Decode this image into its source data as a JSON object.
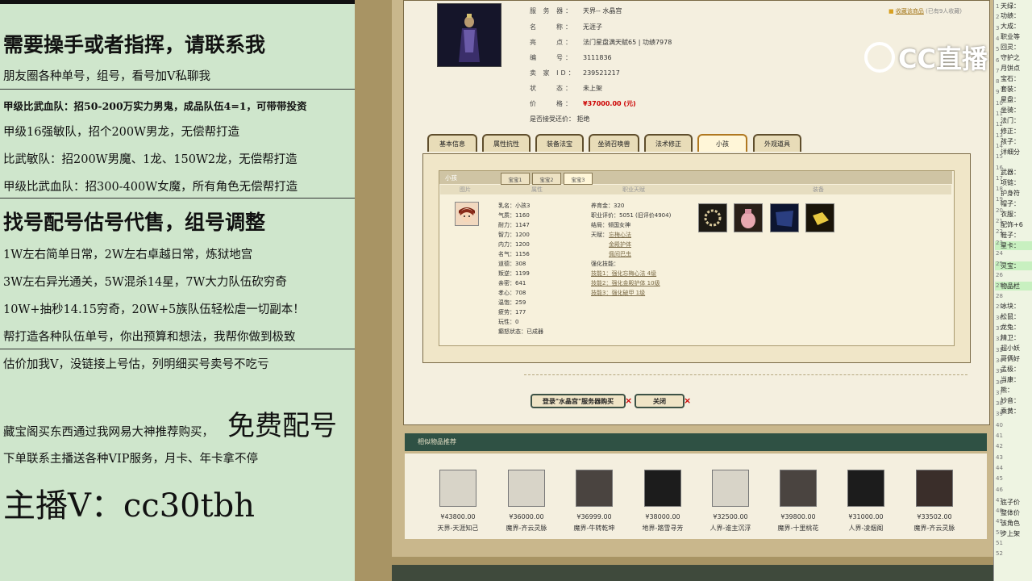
{
  "promo": {
    "lines": [
      "需要操手或者指挥，请联系我",
      "朋友圈各种单号，组号，看号加V私聊我",
      "甲级比武血队：招50-200万实力男鬼，成品队伍4=1，可带带投资",
      "甲级16强敏队，招个200W男龙，无偿帮打造",
      "比武敏队：招200W男魔、1龙、150W2龙，无偿帮打造",
      "甲级比武血队：招300-400W女魔，所有角色无偿帮打造",
      "找号配号估号代售，组号调整",
      "1W左右简单日常，2W左右卓越日常，炼狱地宫",
      "3W左右异光通关，5W混杀14星，7W大力队伍砍穷奇",
      "10W+抽秒14.15穷奇，20W+5族队伍轻松虐一切副本！",
      "帮打造各种队伍单号，你出预算和想法，我帮你做到极致",
      "估价加我V，没链接上号估，列明细买号卖号不吃亏",
      "藏宝阁买东西通过我网易大神推荐购买，",
      "免费配号",
      "下单联系主播送各种VIP服务，月卡、年卡拿不停",
      "主播V：cc30tbh"
    ]
  },
  "logo": {
    "text": "CC直播"
  },
  "info": {
    "server_label": "服 务 器：",
    "server": "天界-- 水晶宫",
    "name_label": "名　　称：",
    "name": "无涯子",
    "highlight_label": "亮　　点：",
    "highlight": "法门星盘满天赋65 | 功绩7978",
    "id_label": "编　　号：",
    "id": "3111836",
    "seller_label": "卖 家 ID：",
    "seller": "239521217",
    "status_label": "状　　态：",
    "status": "未上架",
    "price_label": "价　　格：",
    "price": "¥37000.00 (元)",
    "bargain_label": "是否接受还价：",
    "bargain": "拒绝",
    "fav": "收藏该商品",
    "fav_count": "(已有9人收藏)"
  },
  "tabs": [
    "基本信息",
    "属性抗性",
    "装备法宝",
    "坐骑召唤兽",
    "法术修正",
    "小孩",
    "外观道具"
  ],
  "child": {
    "section": "小孩",
    "subtabs": [
      "宝宝1",
      "宝宝2",
      "宝宝3"
    ],
    "columns": [
      "图片",
      "属性",
      "职业天赋",
      "装备"
    ],
    "stats": [
      "乳名：小孩3",
      "气质：1160",
      "耐力：1147",
      "智力：1200",
      "内力：1200",
      "名气：1156",
      "道德：308",
      "叛逆：1199",
      "亲密：641",
      "孝心：708",
      "温饱：259",
      "疲劳：177",
      "玩性：0",
      "癫怒状态：已成器"
    ],
    "talent": [
      "养育金：320",
      "职业评价：5051 (旧评价4904)",
      "结局：倾国女神"
    ],
    "talent_label": "天赋：",
    "talents": [
      "忘梅心法",
      "金殿护体",
      "佩间巴虫"
    ],
    "skill_label": "强化技能：",
    "skills": [
      "技能1：强化忘梅心法 4级",
      "技能2：强化金殿护体 10级",
      "技能3：强化破甲 1级"
    ]
  },
  "buttons": {
    "buy": "登录\"水晶宫\"服务器购买",
    "close": "关闭"
  },
  "similar": {
    "title": "相似物品推荐",
    "items": [
      {
        "price": "¥43800.00",
        "name": "天界-天涯知己"
      },
      {
        "price": "¥36000.00",
        "name": "魔界-齐云灵脉"
      },
      {
        "price": "¥36999.00",
        "name": "魔界-牛转乾坤"
      },
      {
        "price": "¥38000.00",
        "name": "地界-踏雪寻芳"
      },
      {
        "price": "¥32500.00",
        "name": "人界-谁主沉浮"
      },
      {
        "price": "¥39800.00",
        "name": "魔界-十里桃花"
      },
      {
        "price": "¥31000.00",
        "name": "人界-凌烟阁"
      },
      {
        "price": "¥33502.00",
        "name": "魔界-齐云灵脉"
      }
    ]
  },
  "chat": {
    "lines": [
      "天绿：",
      "功绩：",
      "大成：",
      "职业等",
      "回灵：",
      "守护之",
      "月饼点",
      "宝石：",
      "套装：",
      "星盘：",
      "坐骑：",
      "法门：",
      "修正：",
      "孩子：",
      "详细分",
      "武器：",
      "项链：",
      "护身符",
      "帽子：",
      "衣服：",
      "配饰+6",
      "鞋子：",
      "星卡：",
      "灵宝：",
      "物品栏",
      "冰块：",
      "松鼠：",
      "龙兔：",
      "精卫：",
      "超小妖",
      "哥俩好",
      "孟极：",
      "当康：",
      "熊：",
      "妙音：",
      "乘黄：",
      "底子价",
      "整体价",
      "该角色",
      "步上架"
    ],
    "nums": [
      "1",
      "2",
      "3",
      "4",
      "5",
      "6",
      "7",
      "8",
      "9",
      "10",
      "11",
      "12",
      "13",
      "14",
      "15",
      "16",
      "17",
      "18",
      "19",
      "20",
      "21",
      "22",
      "23",
      "24",
      "25",
      "26",
      "27",
      "28",
      "29",
      "30",
      "31",
      "32",
      "33",
      "34",
      "35",
      "36",
      "37",
      "38",
      "39",
      "40",
      "41",
      "42",
      "43",
      "44",
      "45",
      "46",
      "47",
      "48",
      "49",
      "50",
      "51",
      "52"
    ]
  }
}
